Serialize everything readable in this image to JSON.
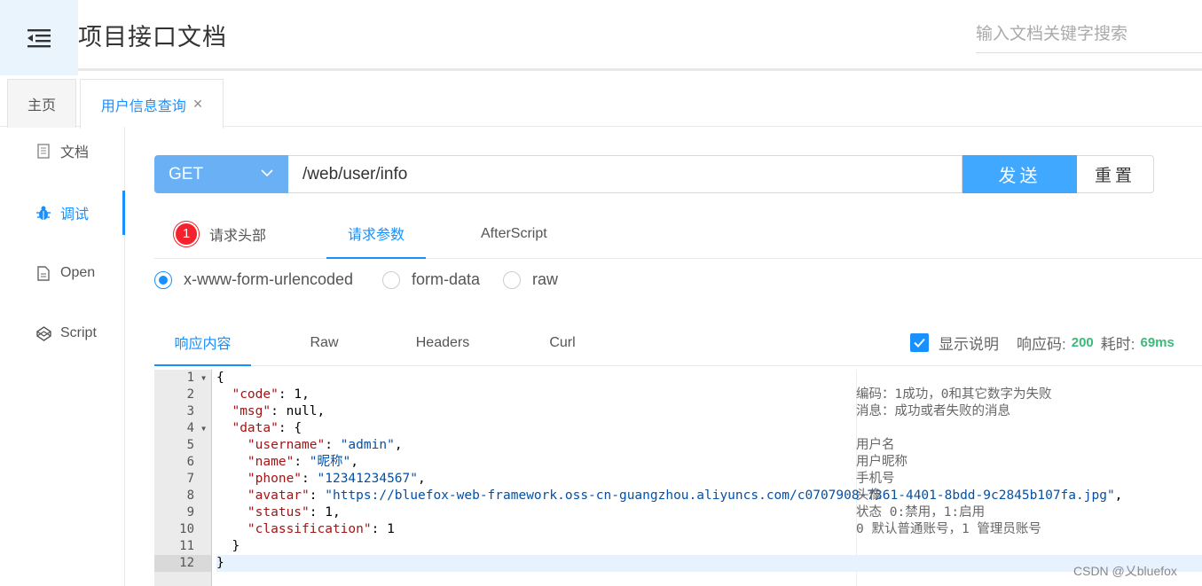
{
  "header": {
    "title": "项目接口文档",
    "search_placeholder": "输入文档关键字搜索"
  },
  "page_tabs": {
    "home": "主页",
    "active": "用户信息查询",
    "close": "×"
  },
  "sidebar": {
    "items": [
      {
        "label": "文档",
        "icon": "document-icon"
      },
      {
        "label": "调试",
        "icon": "bug-icon"
      },
      {
        "label": "Open",
        "icon": "file-icon"
      },
      {
        "label": "Script",
        "icon": "codepen-icon"
      }
    ]
  },
  "request": {
    "method": "GET",
    "url": "/web/user/info",
    "send": "发送",
    "reset": "重置"
  },
  "param_tabs": {
    "headers": "请求头部",
    "headers_badge": "1",
    "params": "请求参数",
    "after": "AfterScript"
  },
  "body_types": {
    "urlencoded": "x-www-form-urlencoded",
    "formdata": "form-data",
    "raw": "raw",
    "selected": "x-www-form-urlencoded"
  },
  "response_tabs": {
    "content": "响应内容",
    "raw": "Raw",
    "headers": "Headers",
    "curl": "Curl"
  },
  "response_meta": {
    "show_desc": "显示说明",
    "code_label": "响应码:",
    "code": "200",
    "time_label": "耗时:",
    "time": "69ms"
  },
  "code_lines": [
    "1",
    "2",
    "3",
    "4",
    "5",
    "6",
    "7",
    "8",
    "9",
    "10",
    "11",
    "12"
  ],
  "json": {
    "code_val": "1",
    "msg_val": "null",
    "username_val": "\"admin\"",
    "name_val": "\"昵称\"",
    "phone_val": "\"12341234567\"",
    "avatar_val": "\"https://bluefox-web-framework.oss-cn-guangzhou.aliyuncs.com/c0707908-7361-4401-8bdd-9c2845b107fa.jpg\"",
    "status_val": "1",
    "classification_val": "1"
  },
  "descriptions": {
    "code": "编码：1成功，0和其它数字为失败",
    "msg": "消息：成功或者失败的消息",
    "username": "用户名",
    "name": "用户昵称",
    "phone": "手机号",
    "avatar": "头像",
    "status": "状态 0:禁用，1:启用",
    "classification": "0 默认普通账号，1 管理员账号"
  },
  "watermark": "CSDN @乂bluefox"
}
